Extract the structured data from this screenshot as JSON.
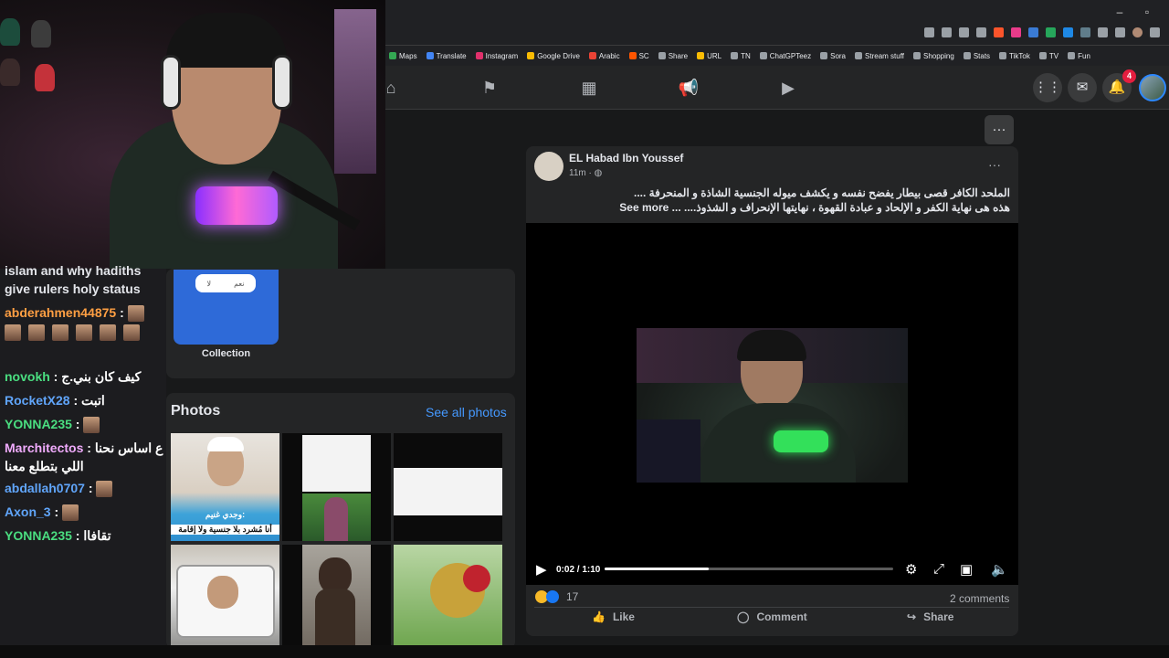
{
  "window": {
    "minimize": "–",
    "restore": "▫"
  },
  "bookmarks": [
    {
      "label": "Maps",
      "color": "#34a853"
    },
    {
      "label": "Translate",
      "color": "#4285f4"
    },
    {
      "label": "Instagram",
      "color": "#e1306c"
    },
    {
      "label": "Google Drive",
      "color": "#fbbc04"
    },
    {
      "label": "Arabic",
      "color": "#ea4335"
    },
    {
      "label": "SC",
      "color": "#ff5500"
    },
    {
      "label": "Share",
      "color": "#9aa0a6"
    },
    {
      "label": "URL",
      "color": "#fbbc04"
    },
    {
      "label": "TN",
      "color": "#9aa0a6"
    },
    {
      "label": "ChatGPTeez",
      "color": "#9aa0a6"
    },
    {
      "label": "Sora",
      "color": "#9aa0a6"
    },
    {
      "label": "Stream stuff",
      "color": "#9aa0a6"
    },
    {
      "label": "Shopping",
      "color": "#9aa0a6"
    },
    {
      "label": "Stats",
      "color": "#9aa0a6"
    },
    {
      "label": "TikTok",
      "color": "#9aa0a6"
    },
    {
      "label": "TV",
      "color": "#9aa0a6"
    },
    {
      "label": "Fun",
      "color": "#9aa0a6"
    }
  ],
  "fb_nav": {
    "notification_count": "4"
  },
  "chat": {
    "top_text": "islam and why hadiths give rulers holy status",
    "messages": [
      {
        "user": "abderahmen44875",
        "sep": " : ",
        "msg": "",
        "color": "orange",
        "emotes": 7
      },
      {
        "user": "novokh",
        "sep": " : ",
        "msg": "كيف كان بني.ج",
        "color": "green",
        "emotes": 0
      },
      {
        "user": "RocketX28",
        "sep": " : ",
        "msg": "اتبت",
        "color": "blue",
        "emotes": 0
      },
      {
        "user": "YONNA235",
        "sep": " : ",
        "msg": "",
        "color": "green",
        "emotes": 1
      },
      {
        "user": "Marchitectos",
        "sep": " : ",
        "msg": "ع اساس نحنا اللي بتطلع معنا",
        "color": "pink",
        "emotes": 0
      },
      {
        "user": "abdallah0707",
        "sep": " : ",
        "msg": "",
        "color": "blue",
        "emotes": 1
      },
      {
        "user": "Axon_3",
        "sep": " : ",
        "msg": "",
        "color": "blue",
        "emotes": 1
      },
      {
        "user": "YONNA235",
        "sep": " : ",
        "msg": "تقافاا",
        "color": "green",
        "emotes": 0
      }
    ]
  },
  "collection": {
    "label": "Collection",
    "pill_left": "لا",
    "pill_right": "نعم"
  },
  "photos": {
    "title": "Photos",
    "see_all": "See all photos",
    "photo1_caption": "وجدي غنيم:",
    "photo1_caption2": "أنا مُشرد بلا جنسية ولا إقامة"
  },
  "post": {
    "author": "EL Habad Ibn Youssef",
    "time": "11m",
    "text_line1": "الملحد الكافر قصى بيطار يفضح نفسه و يكشف ميوله الجنسية الشاذة و المنحرفة ....",
    "text_line2": "هذه هى نهاية الكفر و الإلحاد و عبادة القهوة ، نهايتها الإنحراف و الشذوذ.... ...",
    "see_more": "See more",
    "video_time": "0:02 / 1:10",
    "video_progress": 0.36,
    "reaction_count": "17",
    "comments": "2 comments",
    "like": "Like",
    "comment": "Comment",
    "share": "Share"
  }
}
